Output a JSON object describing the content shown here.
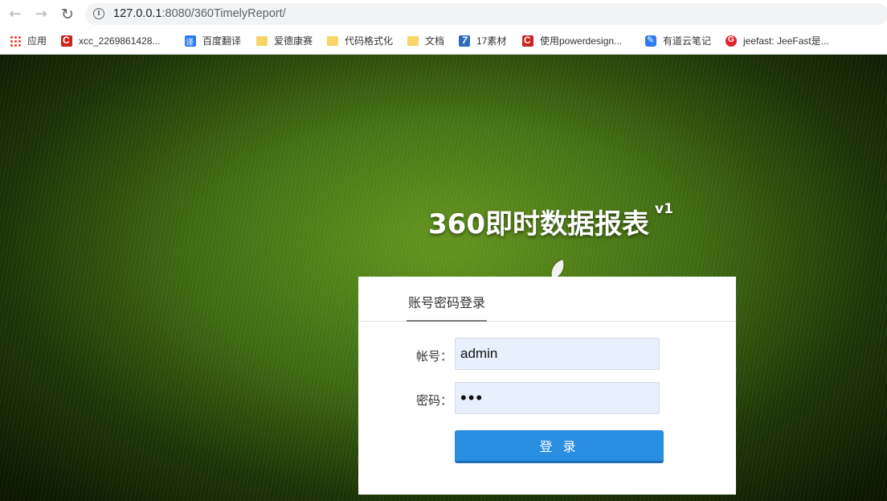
{
  "browser": {
    "url_host": "127.0.0.1",
    "url_rest": ":8080/360TimelyReport/"
  },
  "bookmarks": [
    {
      "label": "应用",
      "icon": "apps-grid-icon"
    },
    {
      "label": "xcc_2269861428...",
      "icon": "csdn-icon"
    },
    {
      "label": "百度翻译",
      "icon": "baidu-fanyi-icon"
    },
    {
      "label": "爱德康赛",
      "icon": "folder-icon"
    },
    {
      "label": "代码格式化",
      "icon": "folder-icon"
    },
    {
      "label": "文档",
      "icon": "folder-icon"
    },
    {
      "label": "17素材",
      "icon": "17sucai-icon"
    },
    {
      "label": "使用powerdesign...",
      "icon": "csdn-icon"
    },
    {
      "label": "有道云笔记",
      "icon": "youdao-icon"
    },
    {
      "label": "jeefast: JeeFast是...",
      "icon": "jeefast-icon"
    }
  ],
  "page": {
    "title": "360即时数据报表",
    "version": "v1"
  },
  "login": {
    "tab_label": "账号密码登录",
    "username_label": "帐号：",
    "username_value": "admin",
    "password_label": "密码：",
    "password_value": "•••",
    "submit_label": "登 录"
  },
  "colors": {
    "accent": "#2a8ee0",
    "input_bg": "#e8f0fe"
  }
}
